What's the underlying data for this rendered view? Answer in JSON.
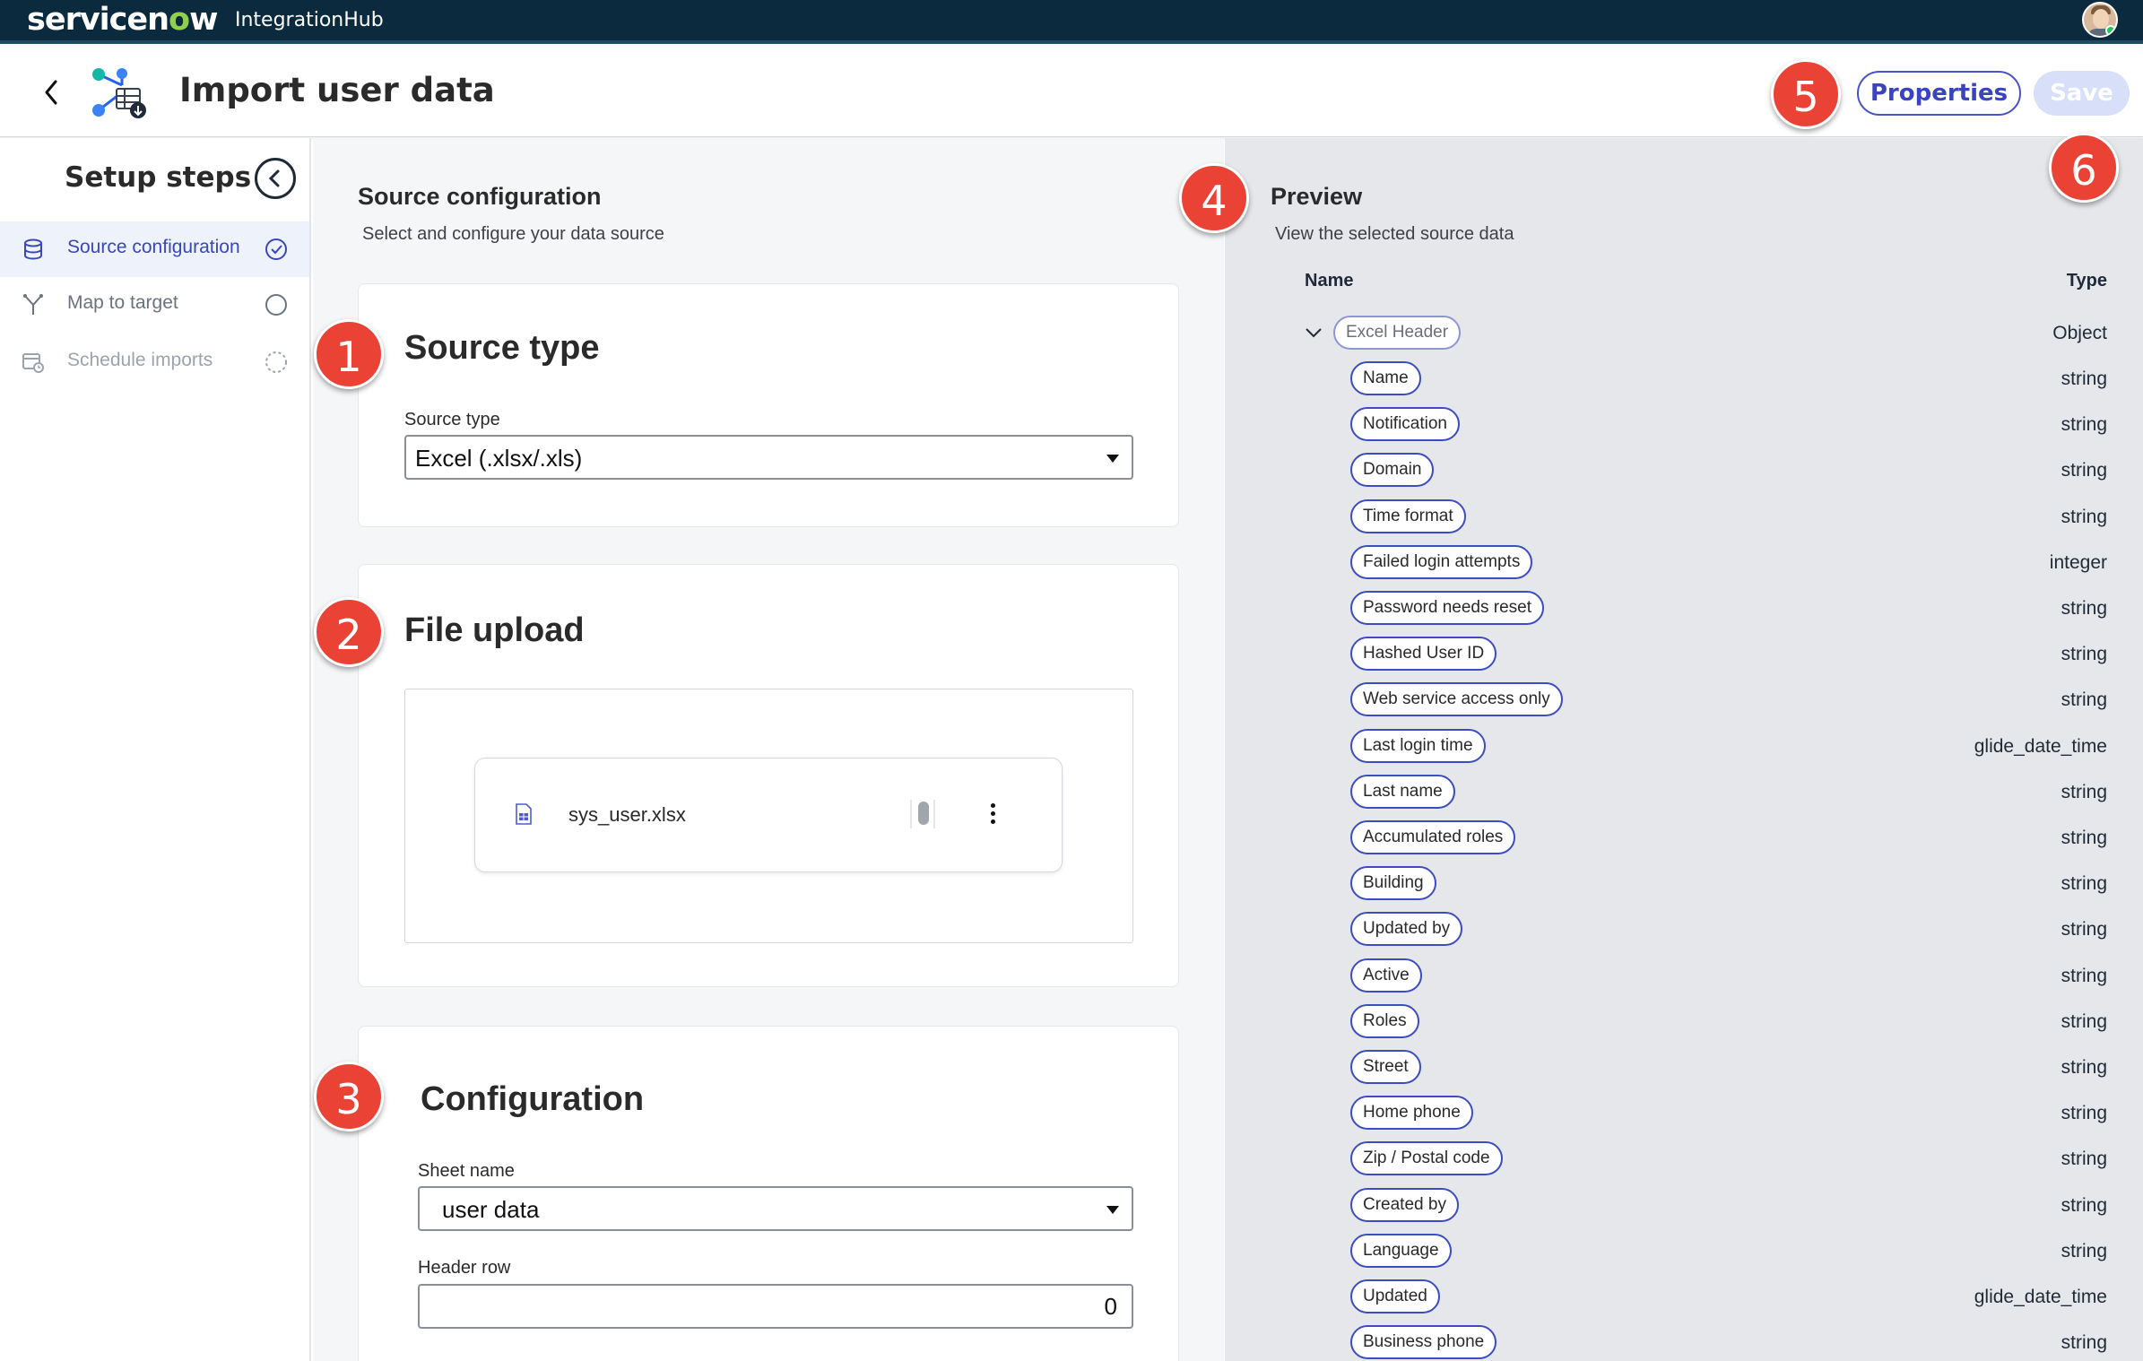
{
  "topnav": {
    "logo_prefix": "servicen",
    "logo_o": "o",
    "logo_suffix": "w",
    "app_name": "IntegrationHub"
  },
  "header": {
    "title": "Import user data",
    "properties_label": "Properties",
    "save_label": "Save"
  },
  "sidebar": {
    "title": "Setup steps",
    "steps": [
      {
        "label": "Source configuration",
        "status": "complete",
        "icon": "database-icon"
      },
      {
        "label": "Map to target",
        "status": "incomplete",
        "icon": "branch-icon"
      },
      {
        "label": "Schedule imports",
        "status": "pending",
        "icon": "calendar-clock-icon"
      }
    ]
  },
  "main": {
    "heading": "Source configuration",
    "subtitle": "Select and configure your data source",
    "source_type": {
      "title": "Source type",
      "field_label": "Source type",
      "value": "Excel (.xlsx/.xls)"
    },
    "file_upload": {
      "title": "File upload",
      "file_name": "sys_user.xlsx"
    },
    "configuration": {
      "title": "Configuration",
      "sheet_label": "Sheet name",
      "sheet_value": "user data",
      "header_row_label": "Header row",
      "header_row_value": "0"
    }
  },
  "preview": {
    "title": "Preview",
    "subtitle": "View the selected source data",
    "col_name": "Name",
    "col_type": "Type",
    "root": {
      "name": "Excel Header",
      "type": "Object"
    },
    "fields": [
      {
        "name": "Name",
        "type": "string"
      },
      {
        "name": "Notification",
        "type": "string"
      },
      {
        "name": "Domain",
        "type": "string"
      },
      {
        "name": "Time format",
        "type": "string"
      },
      {
        "name": "Failed login attempts",
        "type": "integer"
      },
      {
        "name": "Password needs reset",
        "type": "string"
      },
      {
        "name": "Hashed User ID",
        "type": "string"
      },
      {
        "name": "Web service access only",
        "type": "string"
      },
      {
        "name": "Last login time",
        "type": "glide_date_time"
      },
      {
        "name": "Last name",
        "type": "string"
      },
      {
        "name": "Accumulated roles",
        "type": "string"
      },
      {
        "name": "Building",
        "type": "string"
      },
      {
        "name": "Updated by",
        "type": "string"
      },
      {
        "name": "Active",
        "type": "string"
      },
      {
        "name": "Roles",
        "type": "string"
      },
      {
        "name": "Street",
        "type": "string"
      },
      {
        "name": "Home phone",
        "type": "string"
      },
      {
        "name": "Zip / Postal code",
        "type": "string"
      },
      {
        "name": "Created by",
        "type": "string"
      },
      {
        "name": "Language",
        "type": "string"
      },
      {
        "name": "Updated",
        "type": "glide_date_time"
      },
      {
        "name": "Business phone",
        "type": "string"
      }
    ]
  },
  "callouts": [
    "1",
    "2",
    "3",
    "4",
    "5",
    "6"
  ],
  "colors": {
    "nav_bg": "#0b2a3d",
    "accent": "#3c4cc1",
    "callout": "#ea4335",
    "preview_bg": "#e5e7ea"
  }
}
